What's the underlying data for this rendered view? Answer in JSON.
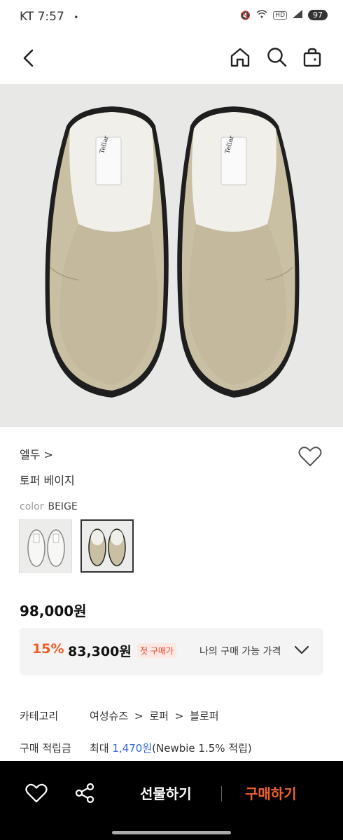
{
  "status_bar": {
    "carrier_time": "KT 7:57",
    "dot": "•",
    "hd": "HD",
    "battery": "97"
  },
  "nav": {
    "back_icon": "back-arrow-icon",
    "home_icon": "home-icon",
    "search_icon": "search-icon",
    "cart_icon": "shopping-bag-icon"
  },
  "product": {
    "brand": "엘두 >",
    "name": "토퍼 베이지",
    "color_label": "color",
    "color_value": "BEIGE",
    "price": "98,000원",
    "discount_rate": "15%",
    "discount_price": "83,300원",
    "first_purchase_badge": "첫 구매가",
    "my_price_label": "나의 구매 가능 가격"
  },
  "details": {
    "category_label": "카테고리",
    "category_path": [
      "여성슈즈",
      "로퍼",
      "블로퍼"
    ],
    "points_label": "구매 적립금",
    "points_prefix": "최대",
    "points_value": "1,470원",
    "points_note": "(Newbie 1.5% 적립)"
  },
  "bottom_bar": {
    "gift_label": "선물하기",
    "buy_label": "구매하기"
  },
  "colors": {
    "accent_orange": "#f05a24",
    "link_blue": "#2f66d6",
    "suede_beige": "#c9bfa3"
  }
}
